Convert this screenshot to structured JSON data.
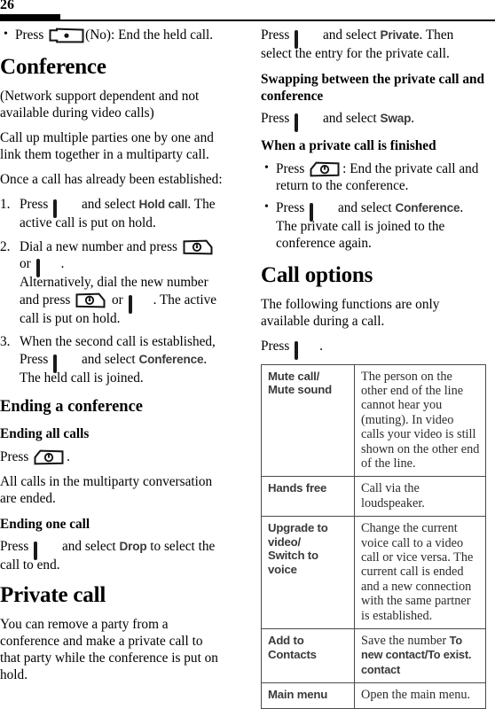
{
  "page": {
    "number": "26"
  },
  "icons": {
    "soft_key": "softkey-button-icon",
    "call_key": "call-key-icon",
    "end_key": "end-call-key-icon",
    "no_key": "no-key-icon"
  },
  "left_column": {
    "bullet_end_held": {
      "pre": "Press ",
      "post": "(No): End the held call."
    },
    "conference_heading": "Conference",
    "conference_note": "(Network support dependent and not available during video calls)",
    "conference_intro": "Call up multiple parties one by one and link them together in a multiparty call.",
    "established_lead": "Once a call has already been established:",
    "steps": [
      {
        "pre": "Press ",
        "mid": " and select ",
        "menu": "Hold call",
        "post": ". The active call is put on hold."
      },
      {
        "p1": "Dial a new number and press ",
        "p2": " or ",
        "p3": ".",
        "p4": "Alternatively, dial the new number and press ",
        "p5": " or ",
        "p6": ". The active call is put on hold."
      },
      {
        "p1": "When the second call is established, Press ",
        "p2": " and select ",
        "menu": "Conference",
        "p3": ". The held call is joined."
      }
    ],
    "ending_conference_heading": "Ending a conference",
    "ending_all_heading": "Ending all calls",
    "ending_all_press": "Press ",
    "ending_all_press_post": ".",
    "ending_all_body": "All calls in the multiparty conversation are ended.",
    "ending_one_heading": "Ending one call",
    "ending_one_pre": "Press ",
    "ending_one_mid": " and select ",
    "ending_one_menu": "Drop",
    "ending_one_post": " to select the call to end.",
    "private_call_heading": "Private call",
    "private_call_body": "You can remove a party from a conference and make a private call to that party while the conference is put on hold."
  },
  "right_column": {
    "private_press_pre": "Press ",
    "private_press_mid": " and select ",
    "private_press_menu": "Private",
    "private_press_post": ". Then select the entry for the private call.",
    "swapping_heading": "Swapping between the private call and conference",
    "swap_pre": "Press ",
    "swap_mid": " and select ",
    "swap_menu": "Swap",
    "swap_post": ".",
    "finished_heading": "When a private call is finished",
    "finished_bullets": [
      {
        "pre": "Press ",
        "post": ": End the private call and return to the conference."
      },
      {
        "pre": "Press ",
        "mid": " and select ",
        "menu": "Conference",
        "post": ". The private call is joined to the conference again."
      }
    ],
    "call_options_heading": "Call options",
    "call_options_intro": "The following functions are only available during a call.",
    "call_options_press_pre": "Press ",
    "call_options_press_post": ".",
    "options_table": {
      "rows": [
        {
          "name": "Mute call/\nMute sound",
          "desc": "The person on the other end of the line cannot hear you (muting). In video calls your video is still shown on the other end of the line."
        },
        {
          "name": "Hands free",
          "desc": "Call via the loudspeaker."
        },
        {
          "name": "Upgrade to video/\nSwitch to voice",
          "desc": "Change the current voice call to a video call or vice versa. The current call is ended and a new connection with the same partner is established."
        },
        {
          "name": "Add to Contacts",
          "desc_pre": "Save the number ",
          "desc_menu": "To new contact/To exist. contact",
          "desc_post": ""
        },
        {
          "name": "Main menu",
          "desc": "Open the main menu."
        }
      ]
    }
  }
}
